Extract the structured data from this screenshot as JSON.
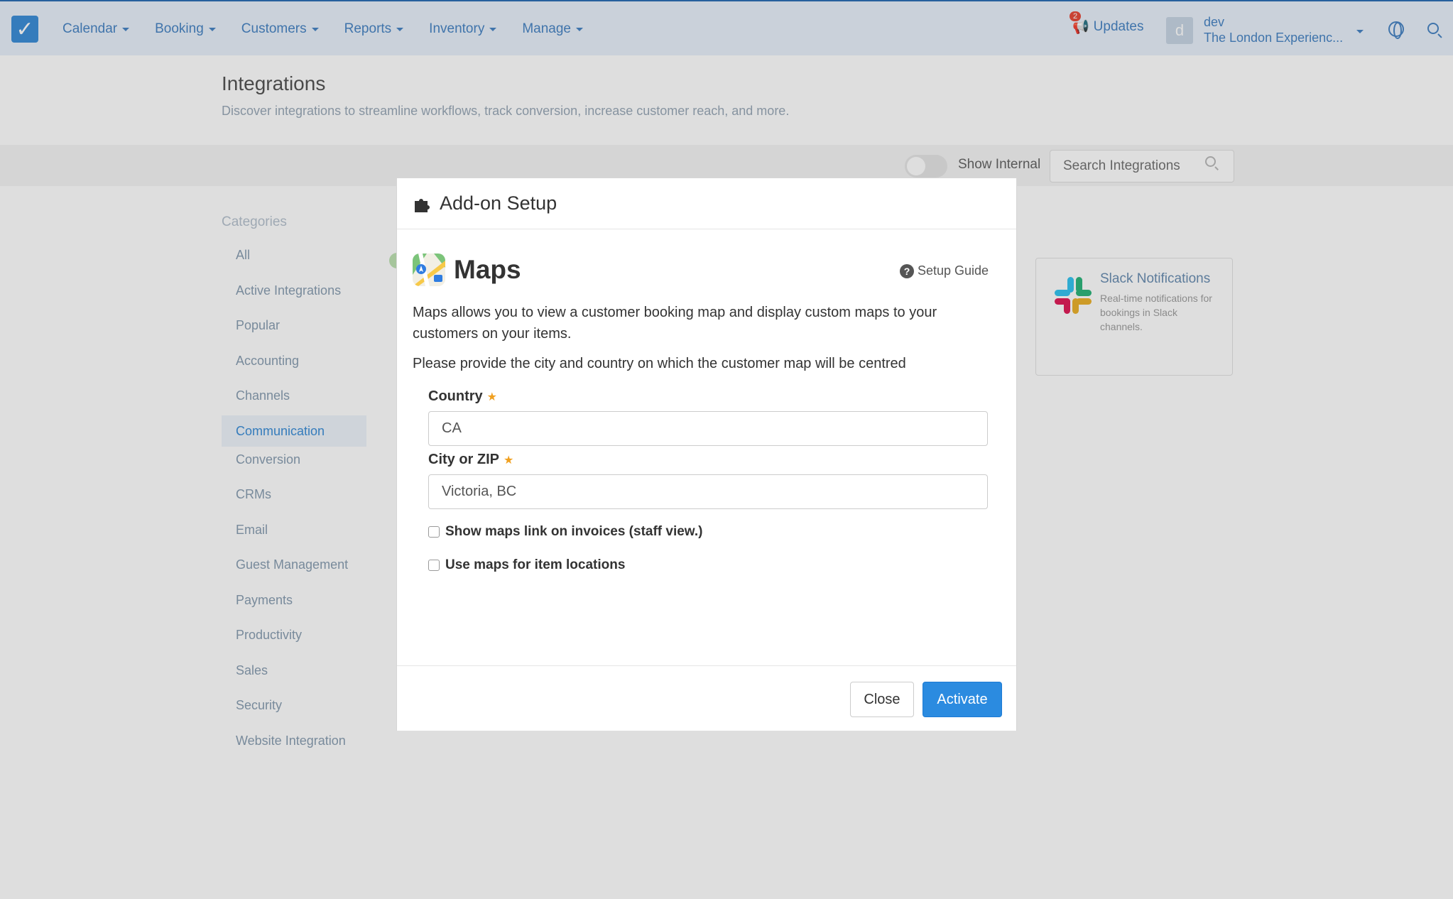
{
  "nav": {
    "items": [
      "Calendar",
      "Booking",
      "Customers",
      "Reports",
      "Inventory",
      "Manage"
    ],
    "updates_label": "Updates",
    "updates_count": "2",
    "avatar_letter": "d",
    "user_name": "dev",
    "company": "The London Experienc..."
  },
  "page": {
    "title": "Integrations",
    "subtitle": "Discover integrations to streamline workflows, track conversion, increase customer reach, and more."
  },
  "toolbar": {
    "show_internal_label": "Show Internal",
    "search_placeholder": "Search Integrations"
  },
  "sidebar": {
    "heading": "Categories",
    "items": [
      "All",
      "Active Integrations",
      "Popular",
      "Accounting",
      "Channels",
      "Communication",
      "Conversion",
      "CRMs",
      "Email",
      "Guest Management",
      "Payments",
      "Productivity",
      "Sales",
      "Security",
      "Website Integration"
    ],
    "active_item": "Communication"
  },
  "card": {
    "title": "Slack Notifications",
    "description": "Real-time notifications for bookings in Slack channels."
  },
  "modal": {
    "title": "Add-on Setup",
    "addon_name": "Maps",
    "setup_guide_label": "Setup Guide",
    "description": "Maps allows you to view a customer booking map and display custom maps to your customers on your items.",
    "instruction": "Please provide the city and country on which the customer map will be centred",
    "country_label": "Country",
    "country_value": "CA",
    "city_label": "City or ZIP",
    "city_value": "Victoria, BC",
    "checkbox_invoices": "Show maps link on invoices (staff view.)",
    "checkbox_items": "Use maps for item locations",
    "close_label": "Close",
    "activate_label": "Activate"
  },
  "colors": {
    "accent": "#2b8be0",
    "nav_link": "#4a86c5",
    "required_star": "#f0a020"
  }
}
